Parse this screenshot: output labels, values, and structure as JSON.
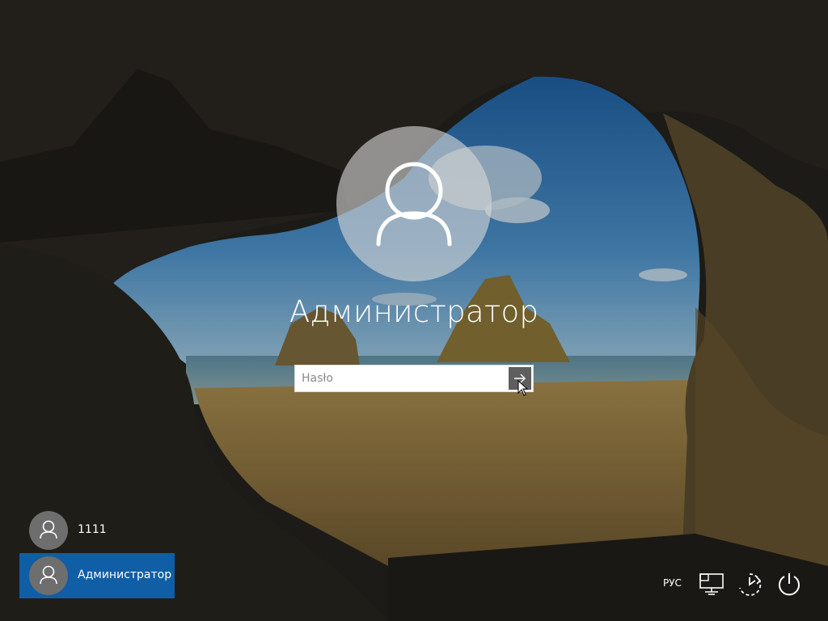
{
  "login": {
    "username": "Администратор",
    "password_placeholder": "Hasło",
    "password_value": ""
  },
  "users": [
    {
      "label": "1111",
      "selected": false
    },
    {
      "label": "Администратор",
      "selected": true
    }
  ],
  "tray": {
    "language": "РУС",
    "icons": [
      "network-icon",
      "accessibility-icon",
      "power-icon"
    ]
  },
  "colors": {
    "selected_user": "#0f5ea6",
    "avatar_bg": "#6e6e6e",
    "submit_button": "#5f5f5f"
  }
}
